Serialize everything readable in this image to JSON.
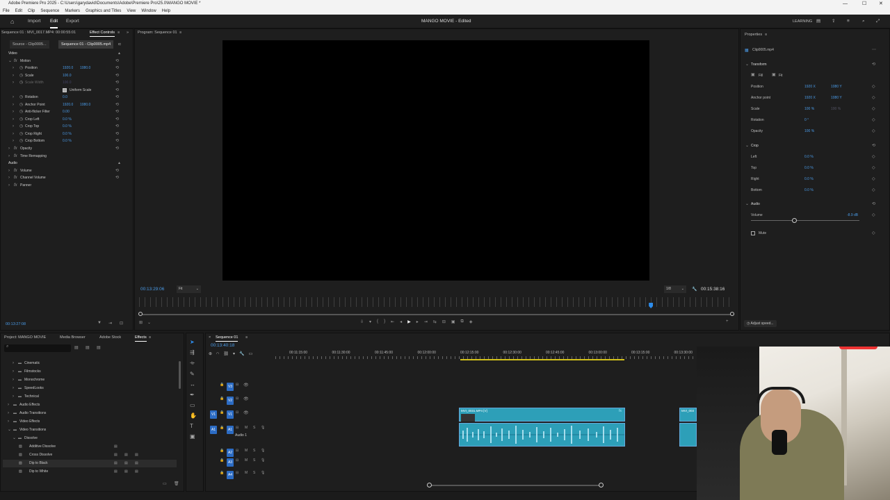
{
  "title_bar": {
    "text": "Adobe Premiere Pro 2025 - C:\\Users\\garydavid\\Documents\\Adobe\\Premiere Pro\\25.0\\MANGO MOVIE *"
  },
  "menu": [
    "File",
    "Edit",
    "Clip",
    "Sequence",
    "Markers",
    "Graphics and Titles",
    "View",
    "Window",
    "Help"
  ],
  "workspace": {
    "tabs": [
      "Import",
      "Edit",
      "Export"
    ],
    "active": "Edit",
    "project_title": "MANGO MOVIE - Edited",
    "learning_label": "LEARNING"
  },
  "effect_controls": {
    "breadcrumb": "Sequence 01 : MVI_0017.MP4: 00:00:55:01",
    "panel_tab": "Effect Controls",
    "source_tab": "Source - Clip0005...",
    "seq_tab": "Sequence 01 - Clip0005.mp4",
    "video_label": "Video",
    "motion_label": "Motion",
    "params": [
      {
        "name": "Position",
        "v1": "1920.0",
        "v2": "1080.0"
      },
      {
        "name": "Scale",
        "v1": "100.0",
        "v2": ""
      },
      {
        "name": "Scale Width",
        "v1": "100.0",
        "v2": ""
      },
      {
        "name": "Uniform Scale",
        "v1": "",
        "v2": ""
      },
      {
        "name": "Rotation",
        "v1": "0.0",
        "v2": ""
      },
      {
        "name": "Anchor Point",
        "v1": "1920.0",
        "v2": "1080.0"
      },
      {
        "name": "Anti-flicker Filter",
        "v1": "0.00",
        "v2": ""
      },
      {
        "name": "Crop Left",
        "v1": "0.0 %",
        "v2": ""
      },
      {
        "name": "Crop Top",
        "v1": "0.0 %",
        "v2": ""
      },
      {
        "name": "Crop Right",
        "v1": "0.0 %",
        "v2": ""
      },
      {
        "name": "Crop Bottom",
        "v1": "0.0 %",
        "v2": ""
      }
    ],
    "opacity_label": "Opacity",
    "time_remap_label": "Time Remapping",
    "audio_label": "Audio",
    "volume_label": "Volume",
    "channel_volume_label": "Channel Volume",
    "panner_label": "Panner",
    "timecode": "00:13:27:08"
  },
  "program": {
    "title": "Program: Sequence 01",
    "timecode_left": "00:13:29:06",
    "fit": "Fit",
    "ratio": "1/8",
    "timecode_right": "00:15:38:16",
    "playhead_fraction": 0.86
  },
  "properties": {
    "title": "Properties",
    "clip_name": "Clip0005.mp4",
    "transform_label": "Transform",
    "fill_label": "Fill",
    "fit_label": "Fit",
    "rows": [
      {
        "label": "Position",
        "v1": "1920 X",
        "v2": "1080 Y"
      },
      {
        "label": "Anchor point",
        "v1": "1920 X",
        "v2": "1080 Y"
      },
      {
        "label": "Scale",
        "v1": "100 %",
        "v2": "100 %"
      },
      {
        "label": "Rotation",
        "v1": "0 °",
        "v2": ""
      },
      {
        "label": "Opacity",
        "v1": "100 %",
        "v2": ""
      }
    ],
    "crop_label": "Crop",
    "crop_rows": [
      {
        "label": "Left",
        "v1": "0.0 %"
      },
      {
        "label": "Top",
        "v1": "0.0 %"
      },
      {
        "label": "Right",
        "v1": "0.0 %"
      },
      {
        "label": "Bottom",
        "v1": "0.0 %"
      }
    ],
    "audio_label": "Audio",
    "volume_label": "Volume",
    "volume_value": "-8.9 dB",
    "volume_fraction": 0.4,
    "mute_label": "Mute",
    "adjust_speed": "Adjust speed..."
  },
  "project": {
    "tabs": [
      "Project: MANGO MOVIE",
      "Media Browser",
      "Adobe Stock",
      "Effects"
    ],
    "active_tab": "Effects",
    "tree": [
      {
        "label": "Cinematic",
        "indent": 2,
        "expanded": false
      },
      {
        "label": "Filmstocks",
        "indent": 2,
        "expanded": false
      },
      {
        "label": "Monochrome",
        "indent": 2,
        "expanded": false
      },
      {
        "label": "SpeedLooks",
        "indent": 2,
        "expanded": false
      },
      {
        "label": "Technical",
        "indent": 2,
        "expanded": false
      },
      {
        "label": "Audio Effects",
        "indent": 1,
        "expanded": false
      },
      {
        "label": "Audio Transitions",
        "indent": 1,
        "expanded": false
      },
      {
        "label": "Video Effects",
        "indent": 1,
        "expanded": false
      },
      {
        "label": "Video Transitions",
        "indent": 1,
        "expanded": true
      },
      {
        "label": "Dissolve",
        "indent": 2,
        "expanded": true
      },
      {
        "label": "Additive Dissolve",
        "indent": 3,
        "item": true
      },
      {
        "label": "Cross Dissolve",
        "indent": 3,
        "item": true
      },
      {
        "label": "Dip to Black",
        "indent": 3,
        "item": true,
        "selected": true
      },
      {
        "label": "Dip to White",
        "indent": 3,
        "item": true
      }
    ]
  },
  "timeline": {
    "seq_tab": "Sequence 01",
    "timecode": "00:13:40:18",
    "ruler": [
      "00:11:15:00",
      "00:11:30:00",
      "00:11:45:00",
      "00:12:00:00",
      "00:12:15:00",
      "00:12:30:00",
      "00:12:45:00",
      "00:13:00:00",
      "00:13:15:00",
      "00:13:30:00"
    ],
    "tracks": [
      {
        "name": "V3",
        "type": "video"
      },
      {
        "name": "V2",
        "type": "video"
      },
      {
        "name": "V1",
        "type": "video",
        "src": "V1"
      },
      {
        "name": "A1",
        "type": "audio",
        "src": "A1",
        "label": "Audio 1"
      },
      {
        "name": "A2",
        "type": "audio"
      },
      {
        "name": "A3",
        "type": "audio"
      },
      {
        "name": "A4",
        "type": "audio"
      }
    ],
    "clips": [
      {
        "label": "MVI_0031.MP4 [V]"
      },
      {
        "label": "MVI_003"
      }
    ]
  },
  "colors": {
    "accent": "#2d8ceb",
    "clip": "#2d9fb8",
    "panel": "#1e1e1e",
    "titlebar": "#f3f3f3"
  }
}
